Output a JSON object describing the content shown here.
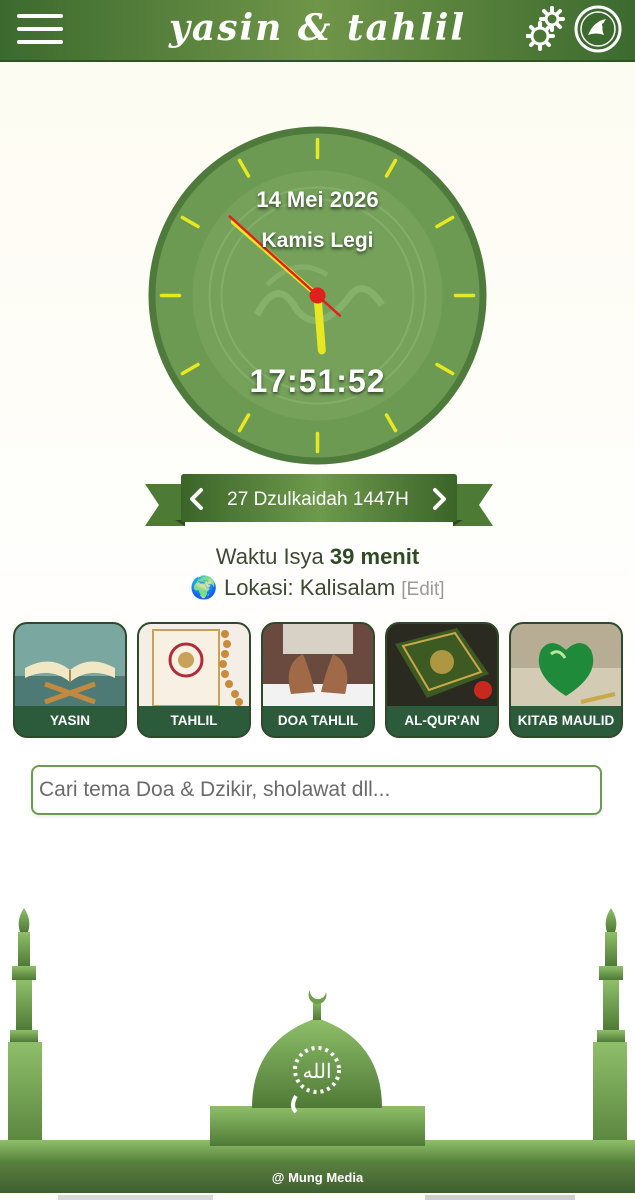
{
  "header": {
    "title": "yasin & tahlil",
    "menu_icon": "hamburger-menu-icon",
    "settings_icon": "gears-icon",
    "logo_icon": "app-logo-icon"
  },
  "clock": {
    "date": "14 Mei 2026",
    "day": "Kamis Legi",
    "time": "17:51:52",
    "hour": 17,
    "minute": 51,
    "second": 52
  },
  "hijri": {
    "date": "27 Dzulkaidah 1447H",
    "prev_icon": "chevron-left-icon",
    "next_icon": "chevron-right-icon"
  },
  "prayer": {
    "label": "Waktu Isya",
    "remaining": "39 menit"
  },
  "location": {
    "label": "Lokasi: Kalisalam",
    "edit": "[Edit]"
  },
  "menu": [
    {
      "label": "YASIN"
    },
    {
      "label": "TAHLIL"
    },
    {
      "label": "DOA TAHLIL"
    },
    {
      "label": "AL-QUR'AN"
    },
    {
      "label": "KITAB MAULID"
    }
  ],
  "search": {
    "placeholder": "Cari tema Doa & Dzikir, sholawat dll...",
    "value": ""
  },
  "footer": {
    "credit": "@ Mung Media"
  },
  "colors": {
    "primary_green": "#3c6a2e",
    "clock_face": "#6d9a52",
    "tick_yellow": "#e8e820",
    "hand_red": "#e0201a",
    "tile_label": "#2c5b3c"
  }
}
